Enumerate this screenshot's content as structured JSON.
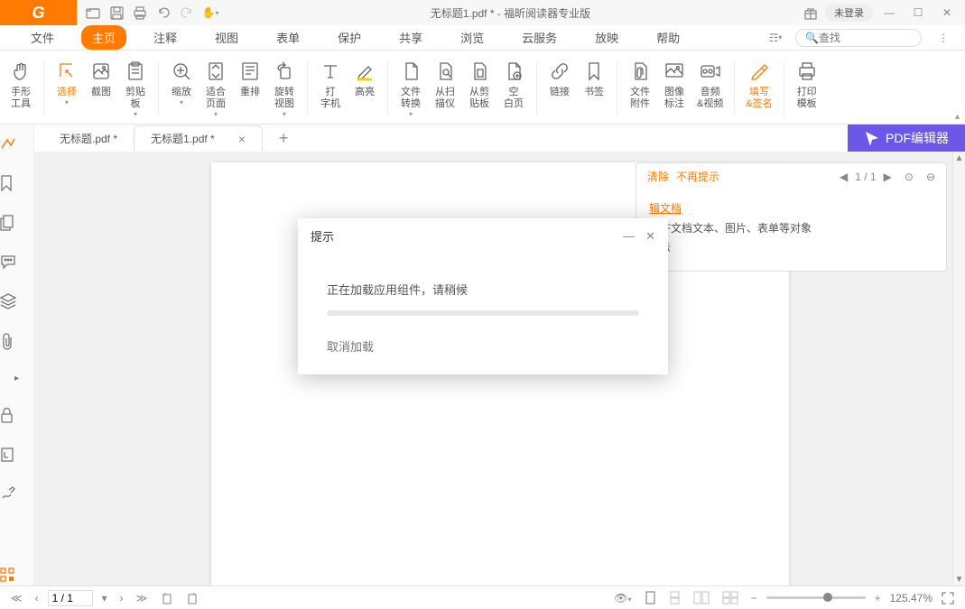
{
  "titlebar": {
    "title": "无标题1.pdf * - 福昕阅读器专业版",
    "login": "未登录"
  },
  "menu": {
    "file": "文件",
    "home": "主页",
    "comment": "注释",
    "view": "视图",
    "form": "表单",
    "protect": "保护",
    "share": "共享",
    "browse": "浏览",
    "cloud": "云服务",
    "play": "放映",
    "help": "帮助",
    "search_placeholder": "查找"
  },
  "ribbon": {
    "hand": "手形\n工具",
    "select": "选择",
    "snapshot": "截图",
    "clipboard": "剪贴\n板",
    "zoom": "缩放",
    "fitpage": "适合\n页面",
    "reflow": "重排",
    "rotate": "旋转\n视图",
    "typewriter": "打\n字机",
    "highlight": "高亮",
    "fileconvert": "文件\n转换",
    "scanner": "从扫\n描仪",
    "clipboard2": "从剪\n贴板",
    "blank": "空\n白页",
    "link": "链接",
    "bookmark": "书签",
    "attach": "文件\n附件",
    "imganno": "图像\n标注",
    "audvid": "音频\n&视频",
    "fillsign": "填写\n&签名",
    "printtpl": "打印\n模板"
  },
  "tabs": {
    "t0": "无标题.pdf *",
    "t1": "无标题1.pdf *"
  },
  "editor_btn": "PDF编辑器",
  "panel": {
    "clear": "清除",
    "noprompt": "不再提示",
    "pager": "1 / 1",
    "link": "辑文档",
    "line1": "PDF文档文本、图片、表单等对象",
    "line2": "是示"
  },
  "modal": {
    "title": "提示",
    "body": "正在加载应用组件，请稍候",
    "cancel": "取消加载"
  },
  "status": {
    "page": "1 / 1",
    "zoom": "125.47%"
  }
}
